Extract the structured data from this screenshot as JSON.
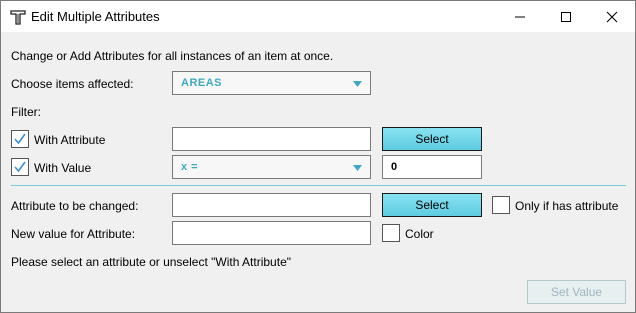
{
  "window": {
    "title": "Edit Multiple Attributes",
    "icon": "t-tool-icon"
  },
  "intro_text": "Change or Add Attributes for all instances of an item at once.",
  "items": {
    "label": "Choose items affected:",
    "selected": "AREAS"
  },
  "filter": {
    "label": "Filter:",
    "with_attribute": {
      "label": "With Attribute",
      "checked": true,
      "value": "",
      "button": "Select"
    },
    "with_value": {
      "label": "With Value",
      "checked": true,
      "operator": "x =",
      "value": "0"
    }
  },
  "change": {
    "attribute_label": "Attribute to be changed:",
    "attribute_value": "",
    "select_button": "Select",
    "only_if_label": "Only if has attribute",
    "only_if_checked": false,
    "new_value_label": "New value for Attribute:",
    "new_value": "",
    "color_label": "Color",
    "color_checked": false
  },
  "message": "Please select an attribute or unselect \"With Attribute\"",
  "set_value_button": "Set Value",
  "colors": {
    "accent": "#5ecbe1",
    "dropdown_text": "#3fa8c0",
    "check": "#3b8fd0",
    "divider": "#7ec8dc"
  }
}
